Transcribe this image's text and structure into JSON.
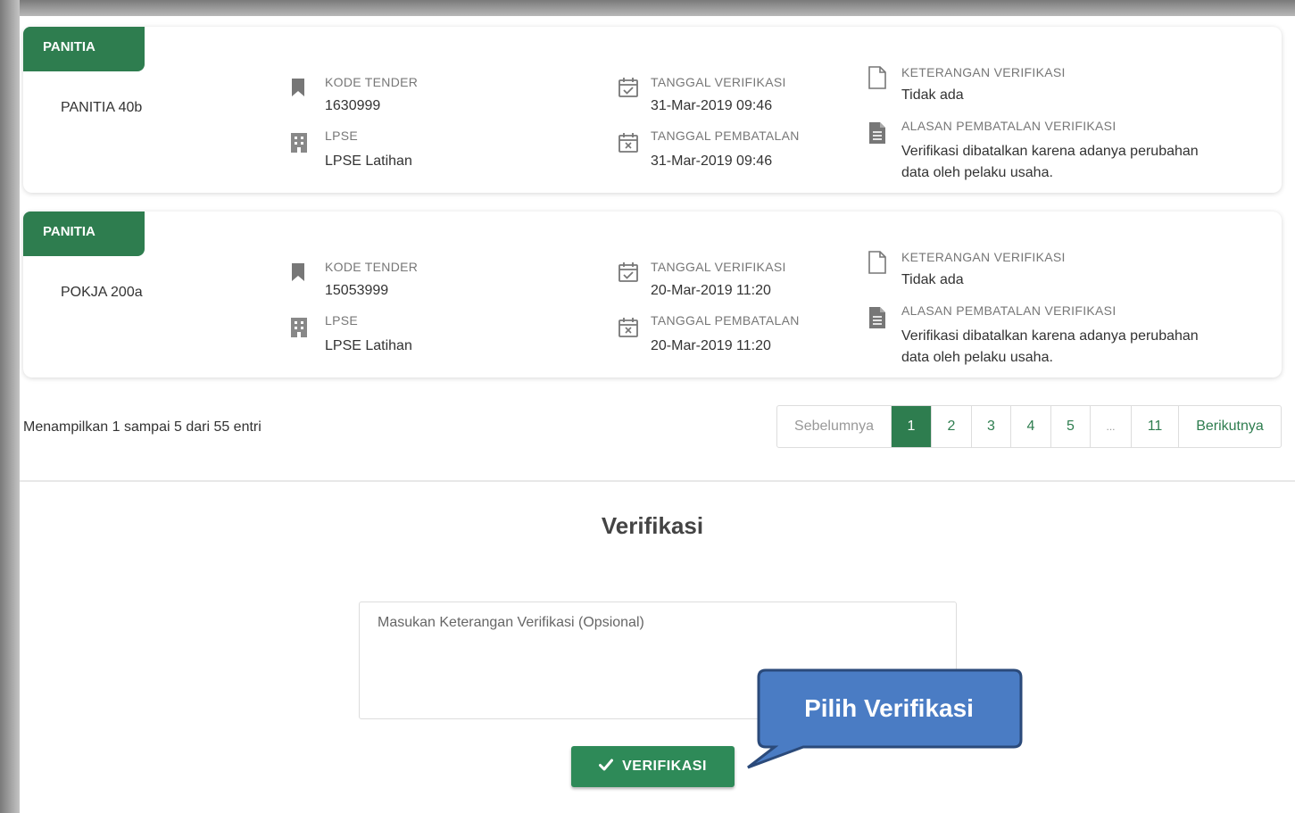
{
  "cards": [
    {
      "badge": "PANITIA",
      "panitia": "PANITIA 40b",
      "kode_label": "KODE TENDER",
      "kode_value": "1630999",
      "lpse_label": "LPSE",
      "lpse_value": "LPSE Latihan",
      "tgl_verif_label": "TANGGAL VERIFIKASI",
      "tgl_verif_value": "31-Mar-2019 09:46",
      "tgl_batal_label": "TANGGAL PEMBATALAN",
      "tgl_batal_value": "31-Mar-2019 09:46",
      "ket_label": "KETERANGAN VERIFIKASI",
      "ket_value": "Tidak ada",
      "alasan_label": "ALASAN PEMBATALAN VERIFIKASI",
      "alasan_value": "Verifikasi dibatalkan karena adanya perubahan data oleh pelaku usaha."
    },
    {
      "badge": "PANITIA",
      "panitia": "POKJA 200a",
      "kode_label": "KODE TENDER",
      "kode_value": "15053999",
      "lpse_label": "LPSE",
      "lpse_value": "LPSE Latihan",
      "tgl_verif_label": "TANGGAL VERIFIKASI",
      "tgl_verif_value": "20-Mar-2019 11:20",
      "tgl_batal_label": "TANGGAL PEMBATALAN",
      "tgl_batal_value": "20-Mar-2019 11:20",
      "ket_label": "KETERANGAN VERIFIKASI",
      "ket_value": "Tidak ada",
      "alasan_label": "ALASAN PEMBATALAN VERIFIKASI",
      "alasan_value": "Verifikasi dibatalkan karena adanya perubahan data oleh pelaku usaha."
    }
  ],
  "pagination": {
    "info": "Menampilkan 1 sampai 5 dari 55 entri",
    "prev": "Sebelumnya",
    "pages": [
      "1",
      "2",
      "3",
      "4",
      "5",
      "...",
      "11"
    ],
    "active_page": "1",
    "next": "Berikutnya"
  },
  "verifikasi": {
    "title": "Verifikasi",
    "placeholder": "Masukan Keterangan Verifikasi (Opsional)",
    "button_label": "VERIFIKASI",
    "button_icon": "check-icon"
  },
  "callout": {
    "text": "Pilih Verifikasi"
  },
  "colors": {
    "primary_green": "#2e7d4f",
    "callout_blue": "#4a7cc4",
    "callout_border": "#2b4a7a"
  }
}
